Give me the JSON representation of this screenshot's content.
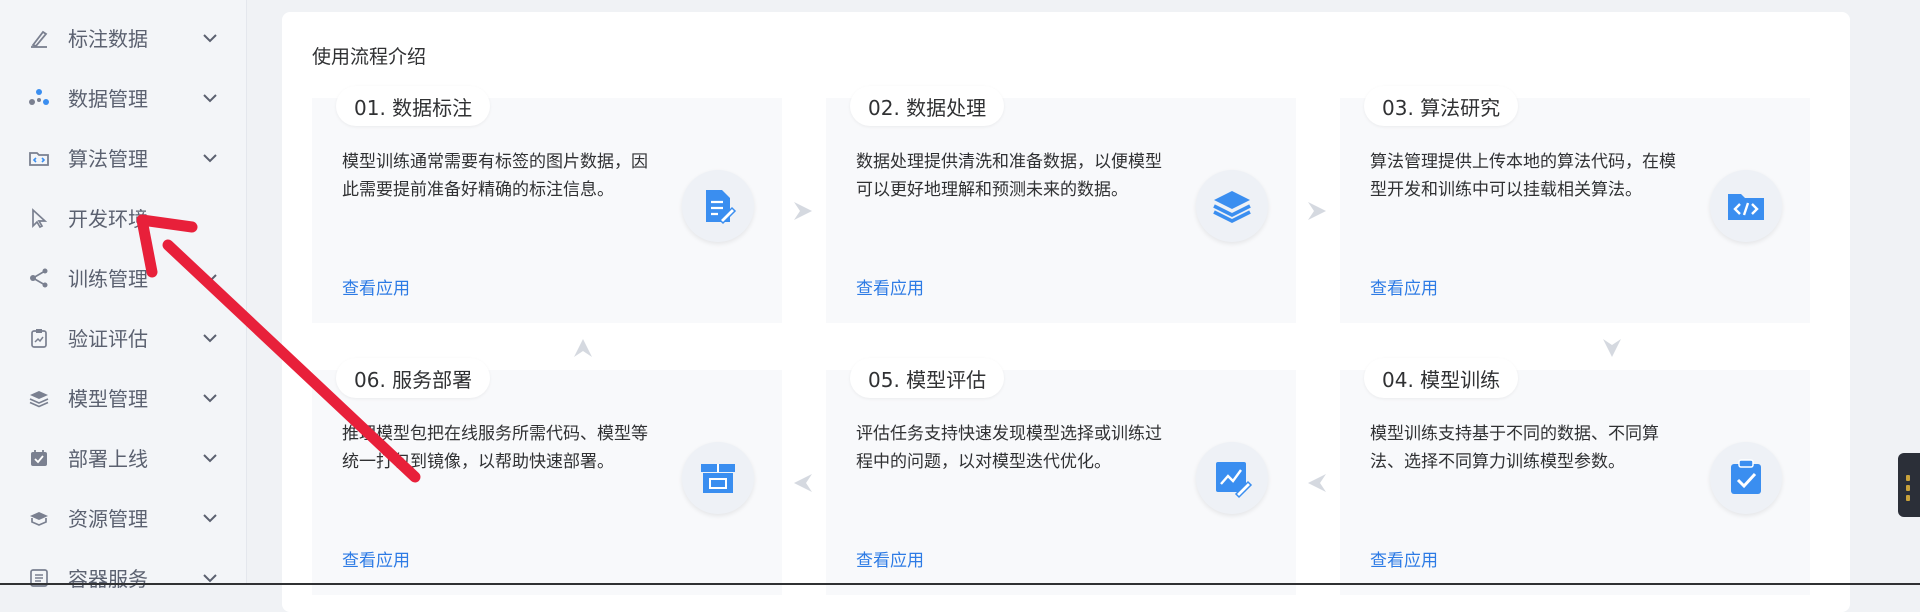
{
  "sidebar": {
    "items": [
      {
        "label": "标注数据",
        "icon": "pen-annotate-icon"
      },
      {
        "label": "数据管理",
        "icon": "data-cluster-icon"
      },
      {
        "label": "算法管理",
        "icon": "code-folder-icon"
      },
      {
        "label": "开发环境",
        "icon": "dev-cursor-icon"
      },
      {
        "label": "训练管理",
        "icon": "share-nodes-icon"
      },
      {
        "label": "验证评估",
        "icon": "clipboard-chart-icon"
      },
      {
        "label": "模型管理",
        "icon": "layers-icon"
      },
      {
        "label": "部署上线",
        "icon": "calendar-check-icon"
      },
      {
        "label": "资源管理",
        "icon": "cube-stack-icon"
      },
      {
        "label": "容器服务",
        "icon": "container-list-icon"
      }
    ]
  },
  "main": {
    "title": "使用流程介绍",
    "steps": [
      {
        "badge": "01. 数据标注",
        "desc": "模型训练通常需要有标签的图片数据，因此需要提前准备好精确的标注信息。",
        "link": "查看应用",
        "icon": "document-edit-icon"
      },
      {
        "badge": "02. 数据处理",
        "desc": "数据处理提供清洗和准备数据，以便模型可以更好地理解和预测未来的数据。",
        "link": "查看应用",
        "icon": "layers-stack-icon"
      },
      {
        "badge": "03. 算法研究",
        "desc": "算法管理提供上传本地的算法代码，在模型开发和训练中可以挂载相关算法。",
        "link": "查看应用",
        "icon": "code-folder-icon"
      },
      {
        "badge": "04. 模型训练",
        "desc": "模型训练支持基于不同的数据、不同算法、选择不同算力训练模型参数。",
        "link": "查看应用",
        "icon": "clipboard-check-icon"
      },
      {
        "badge": "05. 模型评估",
        "desc": "评估任务支持快速发现模型选择或训练过程中的问题，以对模型迭代优化。",
        "link": "查看应用",
        "icon": "chart-pen-icon"
      },
      {
        "badge": "06. 服务部署",
        "desc": "推理模型包把在线服务所需代码、模型等统一打包到镜像，以帮助快速部署。",
        "link": "查看应用",
        "icon": "package-box-icon"
      }
    ]
  },
  "colors": {
    "accent": "#2d7be5",
    "icon_blue": "#3a8ef0",
    "annotation_arrow": "#e8203a"
  }
}
